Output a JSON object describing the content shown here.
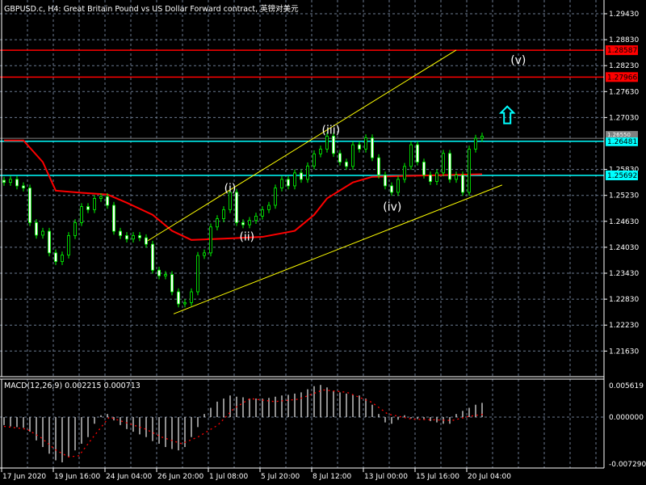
{
  "header": {
    "title": "GBPUSD.c, H4:  Great Britain Pound vs US Dollar Forward contract, 英镑对美元"
  },
  "price_axis": {
    "ticks": [
      "1.29430",
      "1.28830",
      "1.28230",
      "1.27630",
      "1.27030",
      "1.25830",
      "1.25230",
      "1.24630",
      "1.24030",
      "1.23430",
      "1.22830",
      "1.22230",
      "1.21630"
    ]
  },
  "levels": [
    {
      "label": "1.28587",
      "value": 1.28587,
      "color": "#ff0000"
    },
    {
      "label": "1.27966",
      "value": 1.27966,
      "color": "#ff0000"
    },
    {
      "label": "1.26481",
      "value": 1.26481,
      "color": "#00ffff"
    },
    {
      "label": "1.25692",
      "value": 1.25692,
      "color": "#00ffff"
    }
  ],
  "current_price": {
    "label": "1.26550",
    "value": 1.2655,
    "color": "#808080"
  },
  "time_axis": {
    "labels": [
      "17 Jun 2020",
      "19 Jun 16:00",
      "24 Jun 04:00",
      "26 Jun 20:00",
      "1 Jul 08:00",
      "5 Jul 20:00",
      "8 Jul 12:00",
      "13 Jul 00:00",
      "15 Jul 16:00",
      "20 Jul 04:00"
    ]
  },
  "macd": {
    "label": "MACD(12,26,9) 0.002215 0.000713",
    "ticks": [
      "0.005619",
      "0.000000",
      "-0.007290"
    ]
  },
  "wave_labels": [
    {
      "text": "(i)",
      "bar": 35,
      "price": 1.254
    },
    {
      "text": "(ii)",
      "bar": 37.6,
      "price": 1.2428
    },
    {
      "text": "(iii)",
      "bar": 50.6,
      "price": 1.2675
    },
    {
      "text": "(iv)",
      "bar": 60.1,
      "price": 1.2497
    },
    {
      "text": "(v)",
      "bar": 79.6,
      "price": 1.2836
    }
  ],
  "chart_data": {
    "type": "candlestick",
    "title": "GBPUSD.c H4",
    "ylim": [
      1.2133,
      1.2973
    ],
    "closes": [
      1.2553,
      1.256,
      1.2545,
      1.254,
      1.246,
      1.2431,
      1.244,
      1.239,
      1.237,
      1.2385,
      1.243,
      1.246,
      1.2497,
      1.249,
      1.2516,
      1.252,
      1.25,
      1.244,
      1.243,
      1.2422,
      1.243,
      1.2425,
      1.241,
      1.235,
      1.2337,
      1.234,
      1.23,
      1.2272,
      1.2275,
      1.23,
      1.2384,
      1.239,
      1.245,
      1.2469,
      1.249,
      1.253,
      1.246,
      1.2455,
      1.2465,
      1.2475,
      1.249,
      1.25,
      1.254,
      1.256,
      1.2545,
      1.2575,
      1.256,
      1.2591,
      1.2619,
      1.263,
      1.266,
      1.262,
      1.26,
      1.259,
      1.264,
      1.263,
      1.2656,
      1.261,
      1.257,
      1.2545,
      1.253,
      1.256,
      1.259,
      1.264,
      1.26,
      1.257,
      1.2555,
      1.2575,
      1.262,
      1.256,
      1.257,
      1.253,
      1.263,
      1.2655,
      1.266
    ],
    "moving_average": [
      [
        0,
        1.265
      ],
      [
        3,
        1.265
      ],
      [
        6,
        1.26
      ],
      [
        8,
        1.2534
      ],
      [
        12,
        1.2529
      ],
      [
        16,
        1.2525
      ],
      [
        19,
        1.2506
      ],
      [
        23,
        1.2478
      ],
      [
        26,
        1.2441
      ],
      [
        29,
        1.242
      ],
      [
        34,
        1.2423
      ],
      [
        40,
        1.2427
      ],
      [
        45,
        1.2441
      ],
      [
        48,
        1.2478
      ],
      [
        50,
        1.2516
      ],
      [
        54,
        1.2553
      ],
      [
        57,
        1.2566
      ],
      [
        62,
        1.2568
      ],
      [
        74,
        1.2572
      ]
    ],
    "trendlines": [
      {
        "from": [
          22.25,
          1.2418
        ],
        "to": [
          70,
          1.2859
        ],
        "color": "#ffff00"
      },
      {
        "from": [
          26.25,
          1.2249
        ],
        "to": [
          77.1,
          1.2547
        ],
        "color": "#ffff00"
      }
    ],
    "arrow": {
      "bar": 77.9,
      "price": 1.271,
      "direction": "up",
      "color": "#00ffff"
    },
    "macd_hist": [
      -0.0012,
      -0.0014,
      -0.0015,
      -0.0016,
      -0.0022,
      -0.0035,
      -0.0045,
      -0.0055,
      -0.0065,
      -0.0068,
      -0.006,
      -0.005,
      -0.004,
      -0.003,
      -0.001,
      0.0003,
      0.0005,
      -0.0005,
      -0.0012,
      -0.0018,
      -0.0022,
      -0.0026,
      -0.003,
      -0.0036,
      -0.004,
      -0.0045,
      -0.0048,
      -0.005,
      -0.0045,
      -0.003,
      -0.0015,
      0.0005,
      0.0015,
      0.0025,
      0.003,
      0.0035,
      0.0033,
      0.0032,
      0.003,
      0.003,
      0.003,
      0.0031,
      0.0033,
      0.0035,
      0.0036,
      0.0038,
      0.004,
      0.0045,
      0.005,
      0.0052,
      0.0048,
      0.0042,
      0.004,
      0.0038,
      0.0036,
      0.0035,
      0.003,
      0.002,
      0.0005,
      -0.0008,
      -0.001,
      -0.0004,
      0.0003,
      -0.0002,
      -0.0003,
      -0.0004,
      -0.0006,
      -0.0008,
      -0.001,
      -0.001,
      0.0005,
      0.001,
      0.0015,
      0.002,
      0.0023
    ],
    "macd_signal": [
      [
        0,
        -0.0014
      ],
      [
        3.5,
        -0.0018
      ],
      [
        5.6,
        -0.003
      ],
      [
        8.1,
        -0.005
      ],
      [
        10,
        -0.006
      ],
      [
        11.6,
        -0.0058
      ],
      [
        13.8,
        -0.003
      ],
      [
        16.3,
        0.0
      ],
      [
        19.4,
        -0.001
      ],
      [
        21.9,
        -0.0018
      ],
      [
        24.4,
        -0.003
      ],
      [
        27.5,
        -0.004
      ],
      [
        30,
        -0.003
      ],
      [
        33.1,
        -0.0012
      ],
      [
        35.6,
        0.0014
      ],
      [
        38.1,
        0.003
      ],
      [
        41.9,
        0.0025
      ],
      [
        45.6,
        0.0029
      ],
      [
        49.4,
        0.0044
      ],
      [
        53.1,
        0.004
      ],
      [
        56.9,
        0.0024
      ],
      [
        59.4,
        0.0005
      ],
      [
        63.1,
        -0.0003
      ],
      [
        69.4,
        -0.0005
      ],
      [
        71.9,
        0.0001
      ],
      [
        74.4,
        0.0005
      ]
    ],
    "macd_ylim": [
      -0.00729,
      0.005619
    ]
  }
}
